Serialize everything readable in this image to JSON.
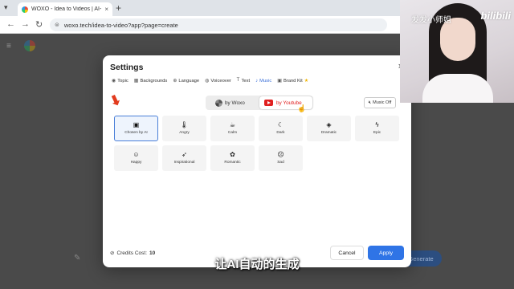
{
  "browser": {
    "tab_title": "WOXO - Idea to Videos | AI-",
    "tab_close": "×",
    "new_tab": "+",
    "url": "woxo.tech/idea-to-video?app?page=create"
  },
  "page": {
    "generate_label": "Generate"
  },
  "modal": {
    "title": "Settings",
    "close": "×",
    "tabs": [
      {
        "label": "Topic",
        "icon": "bulb-icon"
      },
      {
        "label": "Backgrounds",
        "icon": "grid-icon"
      },
      {
        "label": "Language",
        "icon": "globe-icon"
      },
      {
        "label": "Voiceover",
        "icon": "mic-icon"
      },
      {
        "label": "Text",
        "icon": "text-icon"
      },
      {
        "label": "Music",
        "icon": "music-icon"
      },
      {
        "label": "Brand Kit",
        "icon": "brandkit-icon"
      }
    ],
    "source": {
      "woxo_label": "by Woxo",
      "youtube_label": "by Youtube"
    },
    "music_off_label": "Music Off",
    "moods": [
      {
        "label": "Chosen by AI",
        "icon": "ai-chip-icon"
      },
      {
        "label": "Angry",
        "icon": "thermometer-icon"
      },
      {
        "label": "Calm",
        "icon": "coffee-icon"
      },
      {
        "label": "Dark",
        "icon": "moon-icon"
      },
      {
        "label": "Dramatic",
        "icon": "paint-bucket-icon"
      },
      {
        "label": "Epic",
        "icon": "lightning-icon"
      },
      {
        "label": "Happy",
        "icon": "smile-icon"
      },
      {
        "label": "Inspirational",
        "icon": "rocket-icon"
      },
      {
        "label": "Romantic",
        "icon": "flower-icon"
      },
      {
        "label": "Sad",
        "icon": "sad-face-icon"
      }
    ],
    "credits_label": "Credits Cost:",
    "credits_value": "10",
    "cancel_label": "Cancel",
    "apply_label": "Apply"
  },
  "overlay": {
    "streamer_name": "发发小师姐",
    "brand": "bilibili",
    "subtitle": "让AI自动的生成"
  },
  "colors": {
    "accent": "#2f74e6",
    "youtube": "#e02020",
    "arrow": "#e23b1e"
  }
}
